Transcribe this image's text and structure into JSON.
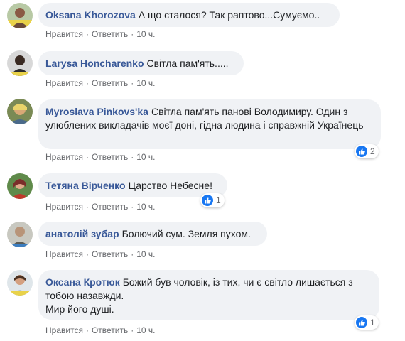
{
  "comments": [
    {
      "author": "Oksana Khorozova",
      "text": "А що сталося? Так раптово...Сумуємо..",
      "like_label": "Нравится",
      "reply_label": "Ответить",
      "time": "10 ч.",
      "reactions": null
    },
    {
      "author": "Larysa Honcharenko",
      "text": "Світла пам'ять.....",
      "like_label": "Нравится",
      "reply_label": "Ответить",
      "time": "10 ч.",
      "reactions": null
    },
    {
      "author": "Myroslava Pinkovs'ka",
      "text": "Світла пам'ять панові Володимиру. Один з улюблених викладачів моєї доні, гідна людина і справжній Українець",
      "like_label": "Нравится",
      "reply_label": "Ответить",
      "time": "10 ч.",
      "reactions": "2"
    },
    {
      "author": "Тетяна Вірченко",
      "text": "Царство Небесне!",
      "like_label": "Нравится",
      "reply_label": "Ответить",
      "time": "10 ч.",
      "reactions": "1"
    },
    {
      "author": "анатолій зубар",
      "text": "Болючий сум. Земля пухом.",
      "like_label": "Нравится",
      "reply_label": "Ответить",
      "time": "10 ч.",
      "reactions": null
    },
    {
      "author": "Оксана Кротюк",
      "text": "Божий був чоловік, із тих, чи є світло лишається з тобою назавжди.\nМир його душі.",
      "like_label": "Нравится",
      "reply_label": "Ответить",
      "time": "10 ч.",
      "reactions": "1"
    }
  ],
  "colors": {
    "author": "#385898",
    "bubble": "#f0f2f5",
    "meta": "#65676b",
    "like": "#1877f2"
  },
  "icons": {
    "reaction": "like-icon"
  }
}
